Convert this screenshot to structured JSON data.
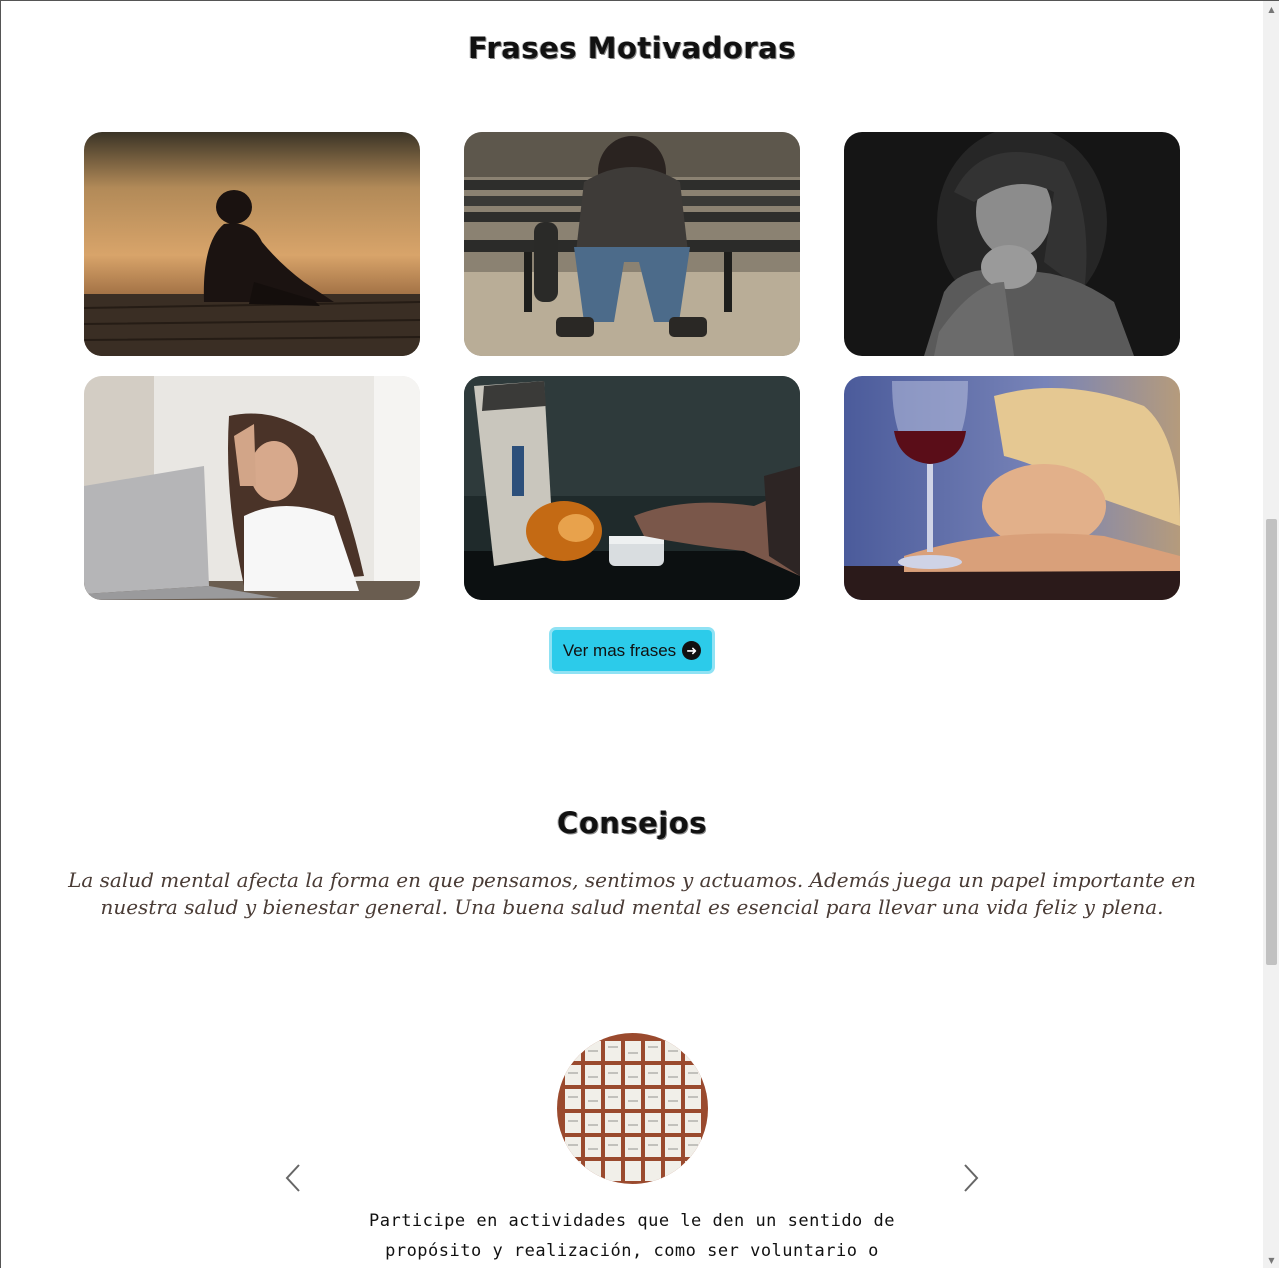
{
  "frases": {
    "title": "Frases Motivadoras",
    "more_button": "Ver mas frases",
    "more_icon": "arrow-right-circle-icon"
  },
  "consejos": {
    "title": "Consejos",
    "intro": "La salud mental afecta la forma en que pensamos, sentimos y actuamos. Además juega un papel importante en nuestra salud y bienestar general. Una buena salud mental es esencial para llevar una vida feliz y plena.",
    "slide_text": "Participe en actividades que le den un sentido de propósito y realización, como ser voluntario o",
    "prev_icon": "chevron-left-icon",
    "next_icon": "chevron-right-icon"
  },
  "colors": {
    "button": "#2ccbea",
    "intro_text": "#4a3c36"
  }
}
